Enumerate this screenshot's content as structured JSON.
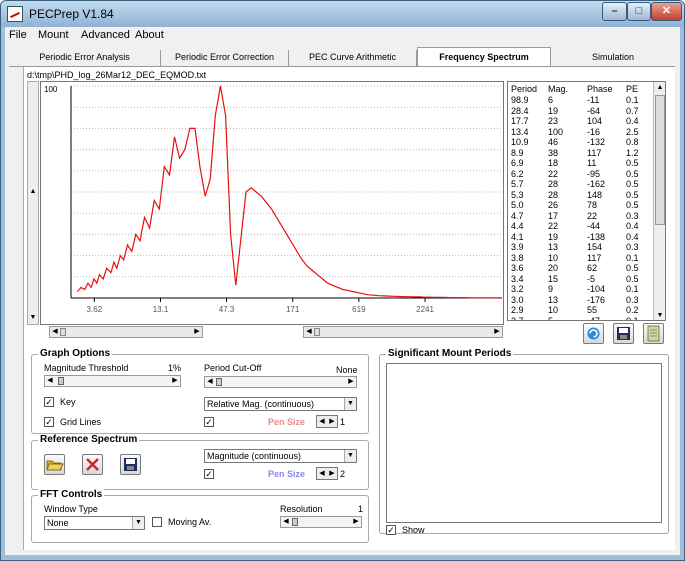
{
  "window": {
    "title": "PECPrep V1.84",
    "minimize": "–",
    "maximize": "□",
    "close": "✕"
  },
  "menu": [
    "File",
    "Mount",
    "Advanced",
    "About"
  ],
  "tabs": [
    "Periodic Error Analysis",
    "Periodic Error Correction",
    "PEC Curve Arithmetic",
    "Frequency Spectrum",
    "Simulation"
  ],
  "active_tab": "Frequency Spectrum",
  "file_path": "d:\\tmp\\PHD_log_26Mar12_DEC_EQMOD.txt",
  "colors": {
    "curve": "#e81010",
    "grid": "#b8b8b8",
    "pen_red": "#e88888",
    "pen_blue": "#8888e8"
  },
  "chart_data": {
    "type": "line",
    "title": "",
    "xlabel": "",
    "ylabel": "",
    "y_top_label": "100",
    "x_tick_labels": [
      "3.62",
      "13.1",
      "47.3",
      "171",
      "619",
      "2241"
    ],
    "x_scale": "log",
    "ylim": [
      0,
      100
    ],
    "grid": true,
    "series": [
      {
        "x": [
          2.6,
          2.8,
          3.0,
          3.2,
          3.4,
          3.6,
          3.8,
          4.0,
          4.3,
          4.6,
          5.0,
          5.3,
          5.6,
          6.0,
          6.4,
          6.9,
          7.5,
          8.1,
          8.8,
          9.6,
          10.6,
          11.6,
          12.8,
          14.1,
          15.6,
          17.2,
          19.0,
          21.0,
          23.2,
          25.6,
          28.2,
          31.2,
          34.4,
          38.0,
          42.0,
          46.4,
          51.2,
          56.6,
          62.5,
          69.0,
          76.2,
          84.1,
          92.9,
          102.6,
          113.3,
          125.1,
          138.2,
          152.6,
          168.5,
          186.1,
          205.5,
          226.9,
          250.6,
          276.7,
          305.6,
          337.4,
          372.6,
          411.5,
          454.4,
          501.7,
          554.0,
          611.8,
          675.6,
          746.0,
          823.8,
          909.7,
          1004.6,
          1109.4,
          1225.0,
          1352.8,
          1493.8,
          1649.6,
          1821.6,
          2011.5,
          2221.3,
          2452.9,
          2708.7,
          2991.1,
          3303.0,
          3647.5,
          4027.8,
          4447.9,
          4911.7,
          5423.9,
          5989.5,
          6614.1,
          7303.8,
          8065.4,
          8906.5,
          9835.3
        ],
        "values": [
          3,
          5,
          4,
          7,
          5,
          9,
          7,
          11,
          9,
          14,
          12,
          17,
          14,
          20,
          18,
          25,
          22,
          30,
          27,
          38,
          33,
          46,
          42,
          62,
          58,
          76,
          66,
          70,
          80,
          80,
          62,
          48,
          56,
          86,
          100,
          86,
          30,
          6,
          28,
          50,
          52,
          50,
          48,
          45,
          42,
          38,
          34,
          30,
          26,
          22,
          18,
          15,
          13,
          11,
          9,
          7,
          6,
          5,
          4,
          3.5,
          3,
          2.5,
          2,
          1.5,
          1.3,
          1.1,
          1,
          0.9,
          0.8,
          0.7,
          0.6,
          0.6,
          0.5,
          0.5,
          0.4,
          0.4,
          0.3,
          0.3,
          0.3,
          0.2,
          0.2,
          0.2,
          0.2,
          0.1,
          0.1,
          0.1,
          0.1,
          0.1,
          0.1,
          0.1
        ]
      }
    ]
  },
  "periods_table": {
    "headers": [
      "Period",
      "Mag.",
      "Phase",
      "PE"
    ],
    "rows": [
      [
        "98.9",
        "6",
        "-11",
        "0.1"
      ],
      [
        "28.4",
        "19",
        "-64",
        "0.7"
      ],
      [
        "17.7",
        "23",
        "104",
        "0.4"
      ],
      [
        "13.4",
        "100",
        "-16",
        "2.5"
      ],
      [
        "10.9",
        "46",
        "-132",
        "0.8"
      ],
      [
        "8.9",
        "38",
        "117",
        "1.2"
      ],
      [
        "6.9",
        "18",
        "11",
        "0.5"
      ],
      [
        "6.2",
        "22",
        "-95",
        "0.5"
      ],
      [
        "5.7",
        "28",
        "-162",
        "0.5"
      ],
      [
        "5.3",
        "28",
        "148",
        "0.5"
      ],
      [
        "5.0",
        "26",
        "78",
        "0.5"
      ],
      [
        "4.7",
        "17",
        "22",
        "0.3"
      ],
      [
        "4.4",
        "22",
        "-44",
        "0.4"
      ],
      [
        "4.1",
        "19",
        "-138",
        "0.4"
      ],
      [
        "3.9",
        "13",
        "154",
        "0.3"
      ],
      [
        "3.8",
        "10",
        "117",
        "0.1"
      ],
      [
        "3.6",
        "20",
        "62",
        "0.5"
      ],
      [
        "3.4",
        "15",
        "-5",
        "0.5"
      ],
      [
        "3.2",
        "9",
        "-104",
        "0.1"
      ],
      [
        "3.0",
        "13",
        "-176",
        "0.3"
      ],
      [
        "2.9",
        "10",
        "55",
        "0.2"
      ],
      [
        "2.7",
        "5",
        "-47",
        "0.1"
      ]
    ]
  },
  "graph_options": {
    "title": "Graph Options",
    "magnitude_threshold_label": "Magnitude Threshold",
    "magnitude_threshold_value": "1%",
    "magnitude_threshold_level": 0.02,
    "period_cutoff_label": "Period Cut-Off",
    "period_cutoff_value": "None",
    "period_cutoff_level": 0.0,
    "key_label": "Key",
    "key_checked": true,
    "gridlines_label": "Grid Lines",
    "gridlines_checked": true,
    "display_mode": "Relative Mag. (continuous)",
    "pen_checked": true,
    "pen_size_label": "Pen Size",
    "pen_size_value": "1"
  },
  "reference_spectrum": {
    "title": "Reference Spectrum",
    "open_icon": "folder-open-icon",
    "delete_icon": "delete-x-icon",
    "save_icon": "floppy-save-icon",
    "display_mode": "Magnitude (continuous)",
    "pen_checked": true,
    "pen_size_label": "Pen Size",
    "pen_size_value": "2"
  },
  "fft_controls": {
    "title": "FFT Controls",
    "window_type_label": "Window Type",
    "window_type_value": "None",
    "moving_av_label": "Moving Av.",
    "moving_av_checked": false,
    "resolution_label": "Resolution",
    "resolution_value": "1",
    "resolution_level": 0.0
  },
  "significant_periods": {
    "title": "Significant Mount Periods",
    "show_label": "Show",
    "show_checked": true
  },
  "table_buttons": [
    "refresh-icon",
    "save-icon",
    "document-icon"
  ]
}
